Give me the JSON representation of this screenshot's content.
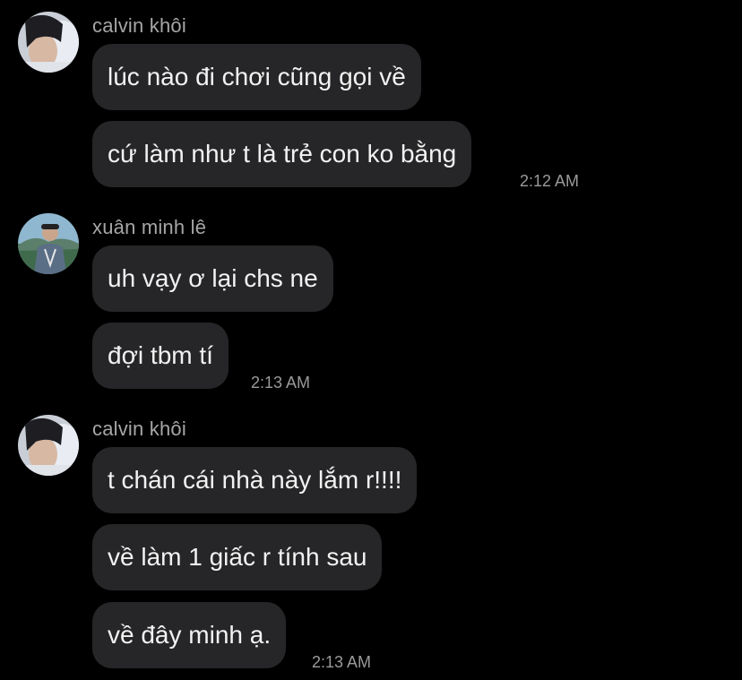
{
  "groups": [
    {
      "sender": "calvin khôi",
      "messages": [
        "lúc nào đi chơi cũng gọi về",
        "cứ làm như t là trẻ con ko bằng"
      ],
      "time": "2:12 AM"
    },
    {
      "sender": "xuân minh lê",
      "messages": [
        "uh vạy ơ lại chs ne",
        "đợi tbm tí"
      ],
      "time": "2:13 AM"
    },
    {
      "sender": "calvin khôi",
      "messages": [
        "t chán cái nhà này lắm r!!!!",
        "về làm 1 giấc r tính sau",
        "về đây minh ạ."
      ],
      "time": "2:13 AM"
    }
  ]
}
